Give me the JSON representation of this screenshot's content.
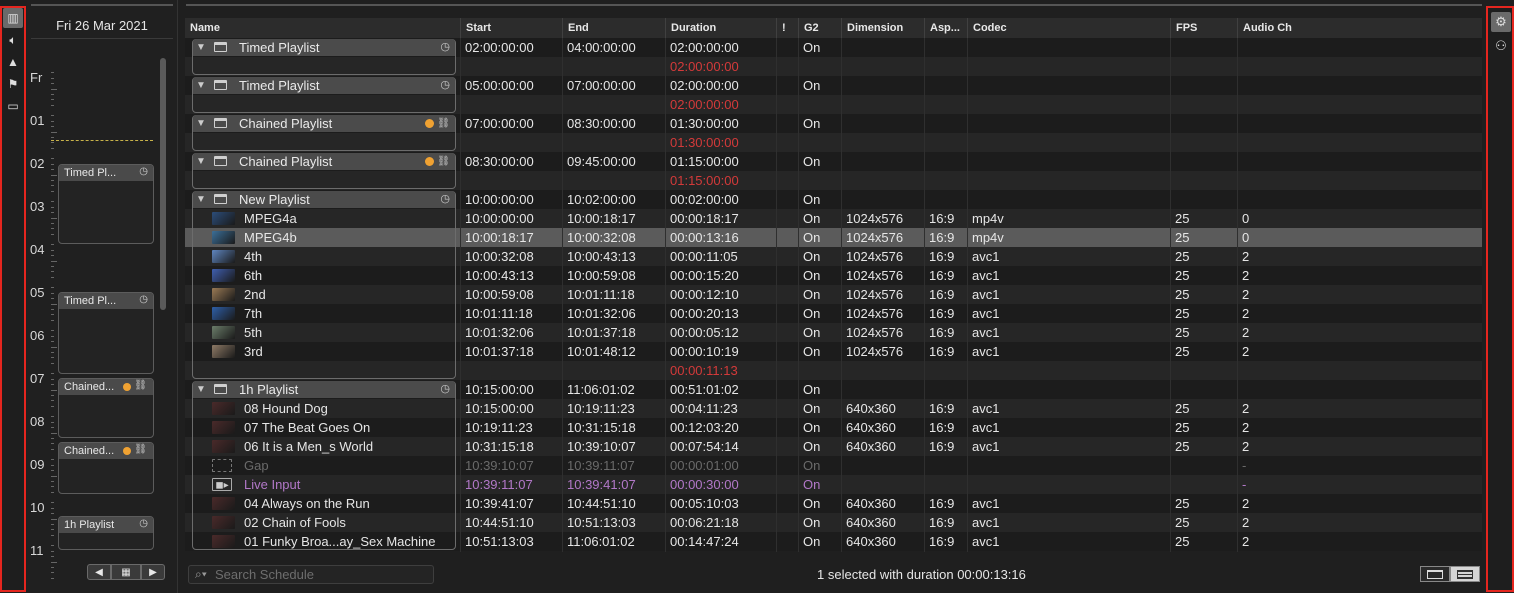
{
  "timeline": {
    "date": "Fri 26 Mar 2021",
    "hours": [
      "Fr",
      "01",
      "02",
      "03",
      "04",
      "05",
      "06",
      "07",
      "08",
      "09",
      "10",
      "11"
    ],
    "blocks": [
      {
        "label": "Timed Pl...",
        "kind": "timed"
      },
      {
        "label": "Timed Pl...",
        "kind": "timed"
      },
      {
        "label": "Chained...",
        "kind": "chained"
      },
      {
        "label": "Chained...",
        "kind": "chained"
      },
      {
        "label": "1h Playlist",
        "kind": "timed"
      }
    ]
  },
  "left_icons": [
    "film-strip-icon",
    "speaker-icon",
    "mountains-icon",
    "flag-icon",
    "window-icon"
  ],
  "right_icons": [
    "gear-icon",
    "people-icon"
  ],
  "columns": [
    "Name",
    "Start",
    "End",
    "Duration",
    "!",
    "G2",
    "Dimension",
    "Asp...",
    "Codec",
    "FPS",
    "Audio Ch"
  ],
  "rows": [
    {
      "type": "group",
      "name": "Timed Playlist",
      "badge": "clock",
      "start": "02:00:00:00",
      "end": "04:00:00:00",
      "dur": "02:00:00:00",
      "g2": "On"
    },
    {
      "type": "gap",
      "dur": "02:00:00:00"
    },
    {
      "type": "group",
      "name": "Timed Playlist",
      "badge": "clock",
      "start": "05:00:00:00",
      "end": "07:00:00:00",
      "dur": "02:00:00:00",
      "g2": "On"
    },
    {
      "type": "gap",
      "dur": "02:00:00:00"
    },
    {
      "type": "group",
      "name": "Chained Playlist",
      "badge": "chain",
      "start": "07:00:00:00",
      "end": "08:30:00:00",
      "dur": "01:30:00:00",
      "g2": "On"
    },
    {
      "type": "gap",
      "dur": "01:30:00:00"
    },
    {
      "type": "group",
      "name": "Chained Playlist",
      "badge": "chain",
      "start": "08:30:00:00",
      "end": "09:45:00:00",
      "dur": "01:15:00:00",
      "g2": "On"
    },
    {
      "type": "gap",
      "dur": "01:15:00:00"
    },
    {
      "type": "group",
      "name": "New Playlist",
      "badge": "clock",
      "start": "10:00:00:00",
      "end": "10:02:00:00",
      "dur": "00:02:00:00",
      "g2": "On"
    },
    {
      "type": "item",
      "name": "MPEG4a",
      "thumb": "#2c4d7a",
      "start": "10:00:00:00",
      "end": "10:00:18:17",
      "dur": "00:00:18:17",
      "g2": "On",
      "dim": "1024x576",
      "asp": "16:9",
      "codec": "mp4v",
      "fps": "25",
      "audio": "0"
    },
    {
      "type": "item",
      "name": "MPEG4b",
      "thumb": "#3b6f98",
      "start": "10:00:18:17",
      "end": "10:00:32:08",
      "dur": "00:00:13:16",
      "g2": "On",
      "dim": "1024x576",
      "asp": "16:9",
      "codec": "mp4v",
      "fps": "25",
      "audio": "0",
      "selected": true
    },
    {
      "type": "item",
      "name": "4th",
      "thumb": "#5f86c0",
      "start": "10:00:32:08",
      "end": "10:00:43:13",
      "dur": "00:00:11:05",
      "g2": "On",
      "dim": "1024x576",
      "asp": "16:9",
      "codec": "avc1",
      "fps": "25",
      "audio": "2"
    },
    {
      "type": "item",
      "name": "6th",
      "thumb": "#3f5fb0",
      "start": "10:00:43:13",
      "end": "10:00:59:08",
      "dur": "00:00:15:20",
      "g2": "On",
      "dim": "1024x576",
      "asp": "16:9",
      "codec": "avc1",
      "fps": "25",
      "audio": "2"
    },
    {
      "type": "item",
      "name": "2nd",
      "thumb": "#9a7a55",
      "start": "10:00:59:08",
      "end": "10:01:11:18",
      "dur": "00:00:12:10",
      "g2": "On",
      "dim": "1024x576",
      "asp": "16:9",
      "codec": "avc1",
      "fps": "25",
      "audio": "2"
    },
    {
      "type": "item",
      "name": "7th",
      "thumb": "#2e5fa8",
      "start": "10:01:11:18",
      "end": "10:01:32:06",
      "dur": "00:00:20:13",
      "g2": "On",
      "dim": "1024x576",
      "asp": "16:9",
      "codec": "avc1",
      "fps": "25",
      "audio": "2"
    },
    {
      "type": "item",
      "name": "5th",
      "thumb": "#6b7d6a",
      "start": "10:01:32:06",
      "end": "10:01:37:18",
      "dur": "00:00:05:12",
      "g2": "On",
      "dim": "1024x576",
      "asp": "16:9",
      "codec": "avc1",
      "fps": "25",
      "audio": "2"
    },
    {
      "type": "item",
      "name": "3rd",
      "thumb": "#8e7a66",
      "start": "10:01:37:18",
      "end": "10:01:48:12",
      "dur": "00:00:10:19",
      "g2": "On",
      "dim": "1024x576",
      "asp": "16:9",
      "codec": "avc1",
      "fps": "25",
      "audio": "2"
    },
    {
      "type": "gap",
      "dur": "00:00:11:13"
    },
    {
      "type": "group",
      "name": "1h Playlist",
      "badge": "clock",
      "start": "10:15:00:00",
      "end": "11:06:01:02",
      "dur": "00:51:01:02",
      "g2": "On"
    },
    {
      "type": "item",
      "name": "08 Hound Dog",
      "thumb": "#4a2a2a",
      "start": "10:15:00:00",
      "end": "10:19:11:23",
      "dur": "00:04:11:23",
      "g2": "On",
      "dim": "640x360",
      "asp": "16:9",
      "codec": "avc1",
      "fps": "25",
      "audio": "2"
    },
    {
      "type": "item",
      "name": "07 The Beat Goes On",
      "thumb": "#4a2a2a",
      "start": "10:19:11:23",
      "end": "10:31:15:18",
      "dur": "00:12:03:20",
      "g2": "On",
      "dim": "640x360",
      "asp": "16:9",
      "codec": "avc1",
      "fps": "25",
      "audio": "2"
    },
    {
      "type": "item",
      "name": "06 It is a Men_s World",
      "thumb": "#4a2a2a",
      "start": "10:31:15:18",
      "end": "10:39:10:07",
      "dur": "00:07:54:14",
      "g2": "On",
      "dim": "640x360",
      "asp": "16:9",
      "codec": "avc1",
      "fps": "25",
      "audio": "2"
    },
    {
      "type": "item",
      "name": "Gap",
      "thumb": "gap",
      "start": "10:39:10:07",
      "end": "10:39:11:07",
      "dur": "00:00:01:00",
      "g2": "On",
      "audio": "-",
      "style": "dim"
    },
    {
      "type": "item",
      "name": "Live Input",
      "thumb": "live",
      "start": "10:39:11:07",
      "end": "10:39:41:07",
      "dur": "00:00:30:00",
      "g2": "On",
      "audio": "-",
      "style": "purple"
    },
    {
      "type": "item",
      "name": "04 Always on the Run",
      "thumb": "#4a2a2a",
      "start": "10:39:41:07",
      "end": "10:44:51:10",
      "dur": "00:05:10:03",
      "g2": "On",
      "dim": "640x360",
      "asp": "16:9",
      "codec": "avc1",
      "fps": "25",
      "audio": "2"
    },
    {
      "type": "item",
      "name": "02 Chain of Fools",
      "thumb": "#4a2a2a",
      "start": "10:44:51:10",
      "end": "10:51:13:03",
      "dur": "00:06:21:18",
      "g2": "On",
      "dim": "640x360",
      "asp": "16:9",
      "codec": "avc1",
      "fps": "25",
      "audio": "2"
    },
    {
      "type": "item",
      "name": "01 Funky Broa...ay_Sex Machine",
      "thumb": "#4a2a2a",
      "start": "10:51:13:03",
      "end": "11:06:01:02",
      "dur": "00:14:47:24",
      "g2": "On",
      "dim": "640x360",
      "asp": "16:9",
      "codec": "avc1",
      "fps": "25",
      "audio": "2"
    }
  ],
  "search": {
    "placeholder": "Search Schedule",
    "value": ""
  },
  "status": "1 selected with duration 00:00:13:16",
  "colors": {
    "accent_red": "#e5261f",
    "orange_dot": "#f0a232",
    "gap_red": "#d33a3a",
    "live_purple": "#b278c8"
  }
}
